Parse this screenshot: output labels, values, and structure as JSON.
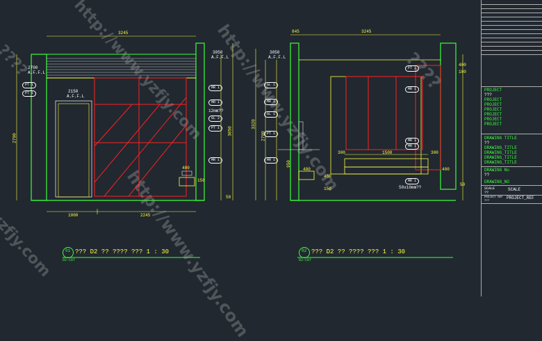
{
  "title_block": {
    "project_label": "PROJECT",
    "project_sub": "???",
    "project_lines": [
      "PROJECT",
      "PROJECT",
      "PROJECT",
      "PROJECT",
      "PROJECT",
      "PROJECT"
    ],
    "drawing_title_label": "DRAWING TITLE",
    "drawing_title_sub": "??",
    "drawing_titles": [
      "DRAWING_TITLE",
      "DRAWING_TITLE",
      "DRAWING_TITLE",
      "DRAWING_TITLE"
    ],
    "drawing_no_label": "DRAWING No",
    "drawing_no_sub": "??",
    "drawing_no": "DRAWING_NO",
    "scale_label": "SCALE",
    "scale_sub": "??",
    "scale_value": "SCALE",
    "project_ref_label": "PROJECT REF",
    "project_ref_sub": "???",
    "project_ref_value": "PROJECT_REF"
  },
  "left_elevation": {
    "top_dim": "3245",
    "bottom_dim_a": "1000",
    "bottom_dim_b": "2245",
    "door_dim_top": "2700",
    "door_dim_top_sub": "A.F.F.L",
    "ceiling_dim": "3050",
    "ceiling_dim_sub": "A.F.F.L",
    "door_height": "2150",
    "door_height_sub": "A.F.F.L",
    "left_height": "2700",
    "right_height": "3050",
    "right_small": "50",
    "glass_note": "12mm??",
    "tags": [
      "PT 1",
      "PT 1",
      "MR 1",
      "MR 1",
      "GL 2",
      "PT 1",
      "MR 1"
    ],
    "inner_dim": "400",
    "inner_dim_v": "150"
  },
  "right_elevation": {
    "top_dim_a": "845",
    "top_dim_b": "3245",
    "ceiling_dim": "3050",
    "ceiling_dim_sub": "A.F.F.L",
    "height_a": "3320",
    "height_b": "2700",
    "height_c": "950",
    "dims_left": [
      "350",
      "220",
      "150",
      "200",
      "200",
      "200",
      "50"
    ],
    "dims_mid": [
      "1500",
      "300",
      "300",
      "400",
      "450",
      "150"
    ],
    "right_dims": [
      "400",
      "100",
      "50",
      "400"
    ],
    "note": "50x10mm??",
    "tags": [
      "PT 1",
      "MR 1",
      "GL 1",
      "MR 1",
      "GL 1",
      "PT 1",
      "MR 1",
      "MR 1",
      "MR 1",
      "MR 1"
    ]
  },
  "captions": {
    "left_num": "01",
    "left_ref": "D2-C07",
    "left_text": "??? D2 ?? ????  ???  1 : 30",
    "right_num": "02",
    "right_ref": "D2-C07",
    "right_text": "??? D2 ?? ????  ???  1 : 30"
  },
  "watermarks": [
    "http://www.yzfjy.com",
    "http://www.yzfjy.com",
    "yzfjy.com",
    "????",
    "????",
    "http://www.yzfjy.com"
  ],
  "colors": {
    "background": "#212830",
    "wall_green": "#3cff3c",
    "dimension_yellow": "#ffff40",
    "accent_red": "#ff2020",
    "text_white": "#ffffff"
  }
}
